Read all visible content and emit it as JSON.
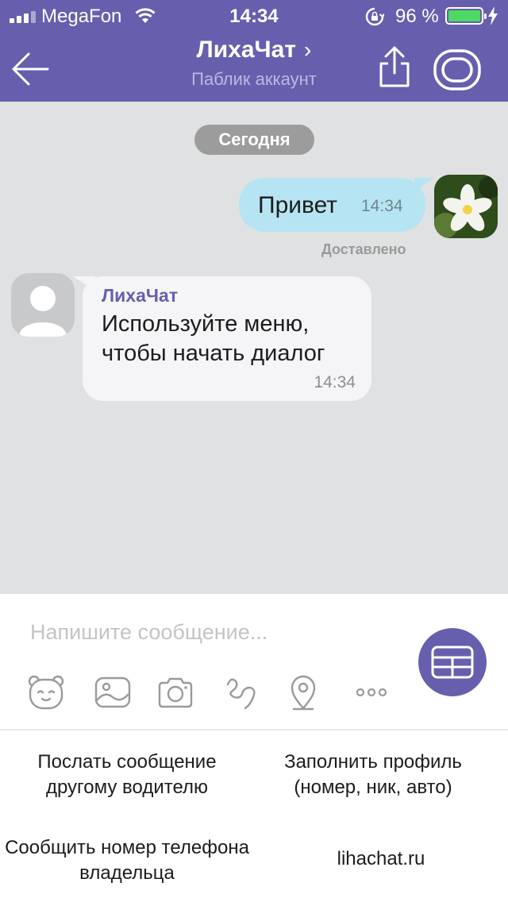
{
  "status_bar": {
    "carrier": "MegaFon",
    "time": "14:34",
    "battery_percent": "96 %",
    "battery_level": 0.96,
    "battery_color": "#4cd964"
  },
  "header": {
    "title": "ЛихаЧат",
    "title_chevron": "›",
    "subtitle": "Паблик аккаунт",
    "background_color": "#665fae"
  },
  "chat": {
    "date_divider": "Сегодня",
    "messages": [
      {
        "direction": "outgoing",
        "text": "Привет",
        "time": "14:34",
        "status": "Доставлено"
      },
      {
        "direction": "incoming",
        "sender": "ЛихаЧат",
        "text": "Используйте меню, чтобы начать диалог",
        "time": "14:34"
      }
    ]
  },
  "composer": {
    "placeholder": "Напишите сообщение...",
    "tools": [
      "sticker-icon",
      "gallery-icon",
      "camera-icon",
      "doodle-icon",
      "location-icon",
      "more-icon"
    ]
  },
  "bot_keyboard": {
    "buttons": [
      {
        "label": "Послать сообщение другому водителю"
      },
      {
        "label": "Заполнить профиль (номер, ник, авто)"
      },
      {
        "label": "Сообщить номер телефона владельца"
      },
      {
        "label": "lihachat.ru"
      }
    ]
  }
}
